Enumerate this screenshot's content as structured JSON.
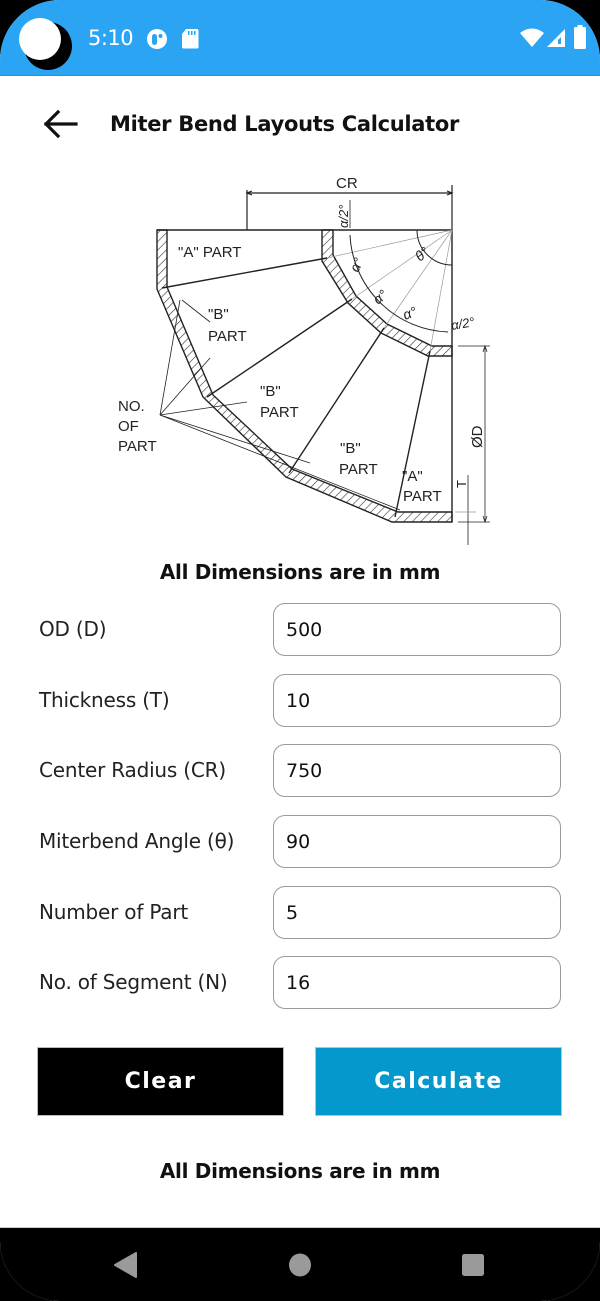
{
  "status_bar": {
    "time": "5:10",
    "icons": [
      "notification-app-icon",
      "sd-card-icon",
      "wifi-icon",
      "cellular-signal-icon",
      "battery-icon"
    ]
  },
  "app_bar": {
    "back_icon": "arrow-left-icon",
    "title": "Miter Bend Layouts Calculator"
  },
  "diagram": {
    "labels": {
      "cr": "CR",
      "half_alpha_top": "α/2°",
      "theta": "θ°",
      "alpha1": "α°",
      "alpha2": "α°",
      "alpha3": "α°",
      "half_alpha_right": "α/2°",
      "a_part_top": "\"A\" PART",
      "b_part_1_q": "\"B\"",
      "b_part_1": "PART",
      "b_part_2_q": "\"B\"",
      "b_part_2": "PART",
      "b_part_3_q": "\"B\"",
      "b_part_3": "PART",
      "a_part_bottom_q": "\"A\"",
      "a_part_bottom": "PART",
      "no_of_part_1": "NO.",
      "no_of_part_2": "OF",
      "no_of_part_3": "PART",
      "od": "ØD",
      "t": "T"
    }
  },
  "dims_note_top": "All Dimensions are in mm",
  "form": {
    "fields": [
      {
        "label": "OD (D)",
        "value": "500"
      },
      {
        "label": "Thickness (T)",
        "value": "10"
      },
      {
        "label": "Center Radius (CR)",
        "value": "750"
      },
      {
        "label": "Miterbend Angle (θ)",
        "value": "90"
      },
      {
        "label": "Number of Part",
        "value": "5"
      },
      {
        "label": "No. of Segment (N)",
        "value": "16"
      }
    ]
  },
  "buttons": {
    "clear": "Clear",
    "calculate": "Calculate"
  },
  "dims_note_bottom": "All Dimensions are in mm",
  "colors": {
    "status_bar": "#2ba5f3",
    "calculate_button": "#0598cc",
    "clear_button": "#000000"
  },
  "nav_bar": {
    "back": "nav-back-icon",
    "home": "nav-home-icon",
    "recents": "nav-recents-icon"
  }
}
